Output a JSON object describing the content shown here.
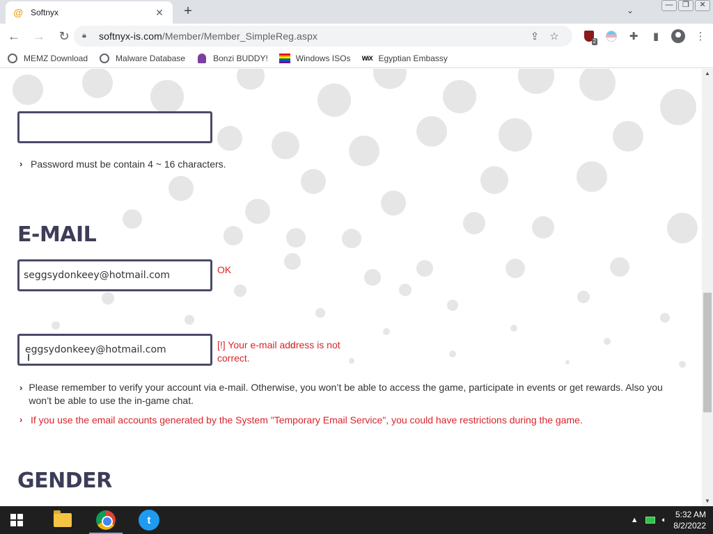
{
  "browser": {
    "tab": {
      "title": "Softnyx",
      "favicon": "softnyx-favicon",
      "close_glyph": "✕"
    },
    "new_tab_glyph": "+",
    "url_host": "softnyx-is.com",
    "url_path": "/Member/Member_SimpleReg.aspx",
    "window_controls": [
      "—",
      "❐",
      "✕"
    ],
    "extension_badge": "2",
    "bookmarks": [
      {
        "label": "MEMZ Download",
        "icon": "globe-icon"
      },
      {
        "label": "Malware Database",
        "icon": "globe-icon"
      },
      {
        "label": "Bonzi BUDDY!",
        "icon": "bonzi-icon"
      },
      {
        "label": "Windows ISOs",
        "icon": "rainbow-flag-icon"
      },
      {
        "label": "Egyptian Embassy",
        "icon": "wix-icon"
      }
    ]
  },
  "page": {
    "password": {
      "value": "",
      "hint": "Password must be contain 4 ~ 16 characters."
    },
    "email": {
      "title": "E-MAIL",
      "value": "seggsydonkeey@hotmail.com",
      "status": "OK",
      "confirm_value": "eggsydonkeey@hotmail.com",
      "confirm_status_line1": "[!] Your e-mail address is not",
      "confirm_status_line2": "correct.",
      "note_verify": "Please remember to verify your account via e-mail. Otherwise, you won’t be able to access the game, participate in events or get rewards. Also you won’t be able to use the in-game chat.",
      "note_temp": "If you use the email accounts generated by the System \"Temporary Email Service\", you could have restrictions during the game."
    },
    "gender": {
      "title": "GENDER"
    }
  },
  "colors": {
    "section_title": "#3d3d58",
    "error_red": "#d9242a",
    "field_border": "#4a4a6a",
    "dot_gray": "#e6e6e6"
  },
  "taskbar": {
    "apps": [
      "file-explorer-icon",
      "chrome-icon",
      "twitter-icon"
    ],
    "time": "5:32 AM",
    "date": "8/2/2022"
  }
}
